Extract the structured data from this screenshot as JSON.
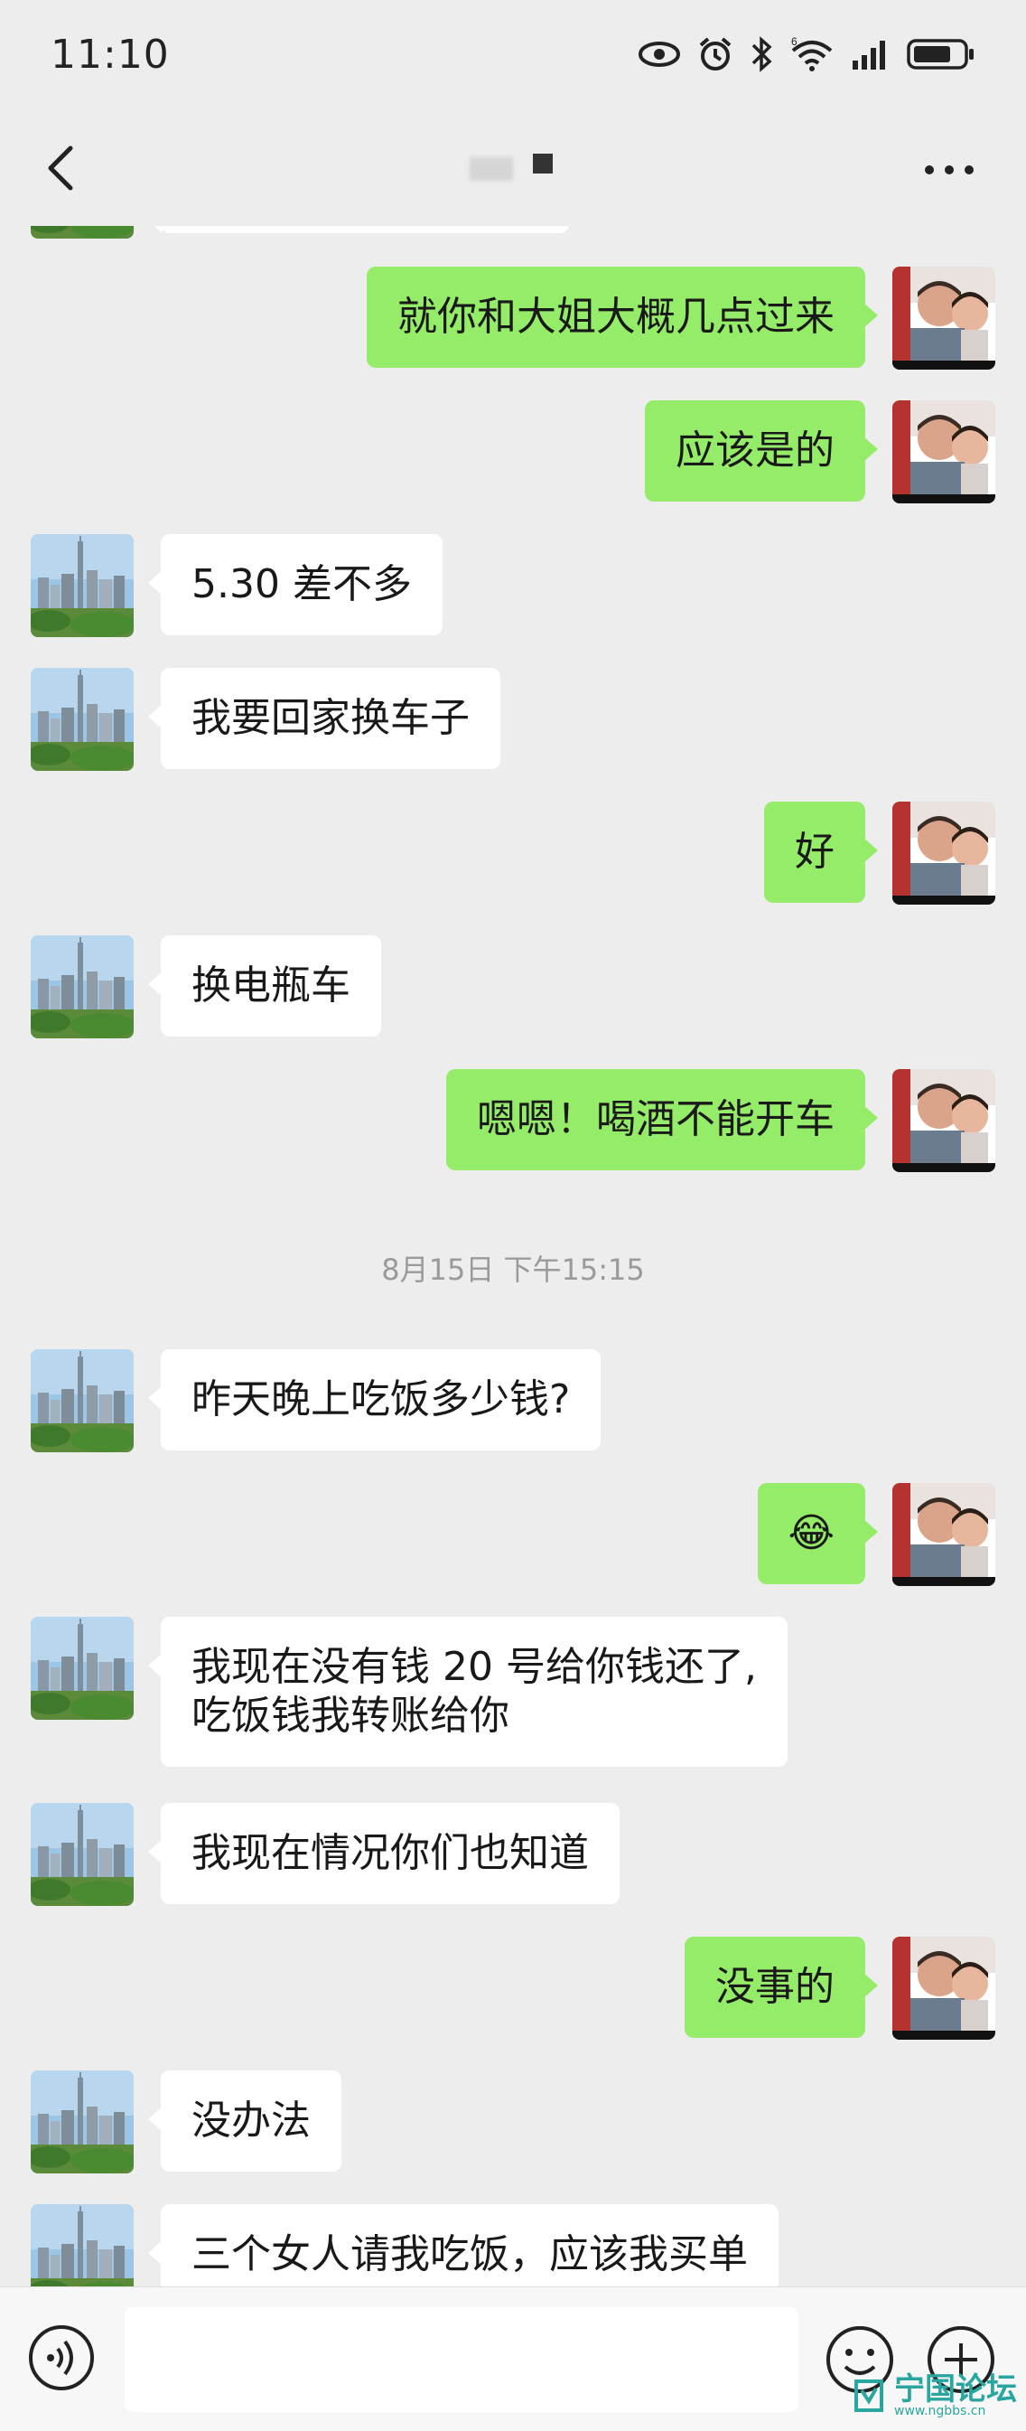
{
  "status_bar": {
    "time": "11:10"
  },
  "header": {
    "title": ""
  },
  "messages": [
    {
      "side": "out",
      "text": "就你和大姐大概几点过来"
    },
    {
      "side": "out",
      "text": "应该是的"
    },
    {
      "side": "in",
      "text": "5.30 差不多"
    },
    {
      "side": "in",
      "text": "我要回家换车子"
    },
    {
      "side": "out",
      "text": "好"
    },
    {
      "side": "in",
      "text": "换电瓶车"
    },
    {
      "side": "out",
      "text": "嗯嗯！喝酒不能开车"
    },
    {
      "timestamp": "8月15日 下午15:15"
    },
    {
      "side": "in",
      "text": "昨天晚上吃饭多少钱?"
    },
    {
      "side": "out",
      "text": "😂"
    },
    {
      "side": "in",
      "text": "我现在没有钱 20 号给你钱还了,\n吃饭钱我转账给你"
    },
    {
      "side": "in",
      "text": "我现在情况你们也知道"
    },
    {
      "side": "out",
      "text": "没事的"
    },
    {
      "side": "in",
      "text": "没办法"
    },
    {
      "side": "in",
      "text": "三个女人请我吃饭，应该我买单"
    }
  ],
  "input": {
    "value": "",
    "placeholder": ""
  },
  "watermark": {
    "main": "宁国论坛",
    "sub": "www.ngbbs.cn"
  },
  "colors": {
    "background": "#ededed",
    "outgoing_bubble": "#95ec69",
    "incoming_bubble": "#ffffff"
  }
}
